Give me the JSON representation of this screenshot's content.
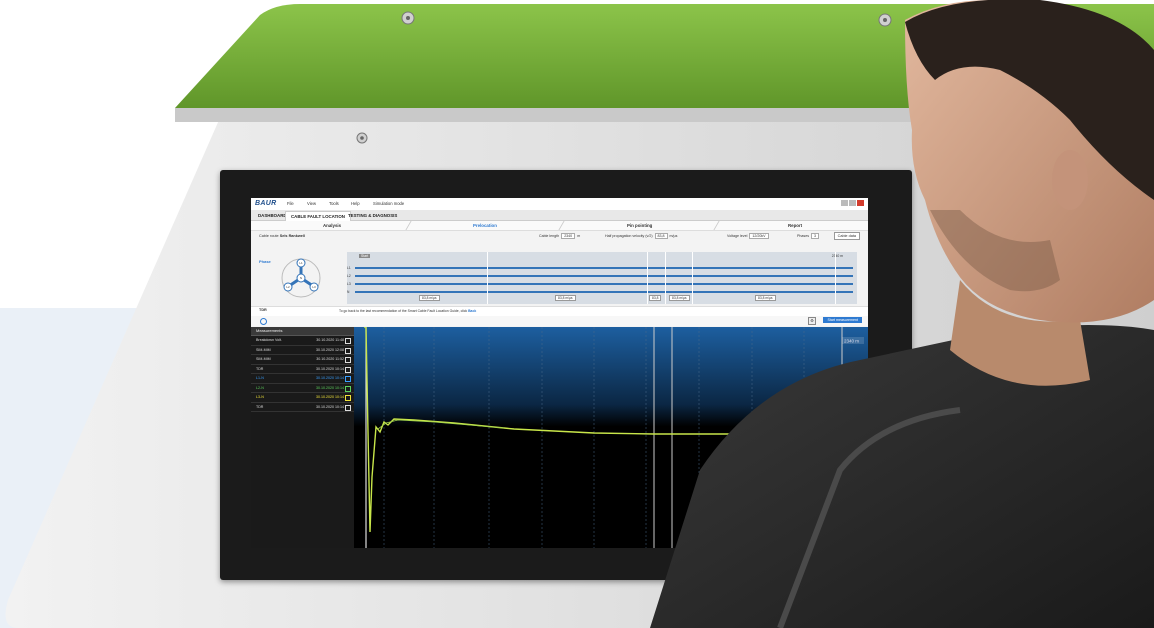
{
  "app": {
    "brand": "BAUR",
    "menu": [
      "File",
      "View",
      "Tools",
      "Help",
      "Simulation mode"
    ],
    "tabs": [
      "DASHBOARD",
      "CABLE FAULT LOCATION",
      "TESTING & DIAGNOSIS"
    ],
    "active_tab": "CABLE FAULT LOCATION",
    "steps": [
      "Analysis",
      "Prelocation",
      "Pin pointing",
      "Report"
    ],
    "active_step": "Prelocation"
  },
  "params": {
    "cable_route_label": "Cable route",
    "cable_route_value": "Sels Rankwell",
    "cable_length_label": "Cable length",
    "cable_length_value": "2340",
    "cable_length_unit": "m",
    "velocity_label": "Half propagation velocity (v/2)",
    "velocity_value": "83,8",
    "velocity_unit": "m/µs",
    "voltage_label": "Voltage level",
    "voltage_value": "12/20kV",
    "phases_label": "Phases",
    "phases_value": "3",
    "cable_data_button": "Cable data"
  },
  "phase_panel": {
    "label": "Phase",
    "nodes": [
      "L1",
      "L2",
      "L3",
      "N"
    ]
  },
  "cable_lines": {
    "labels": [
      "L1",
      "L2",
      "L3",
      "N"
    ],
    "start_label": "Start",
    "end_distance": "2340 m",
    "velocities": [
      "83,8 m/µs",
      "83,8 m/µs",
      "83,8",
      "83,8 m/µs",
      "83,8 m/µs"
    ]
  },
  "hint": {
    "selector": "TDR",
    "text": "To go back to the last recommendation of the Smart Cable Fault Location Guide, click",
    "link": "Back"
  },
  "toolbar": {
    "start_measurement": "Start measurement"
  },
  "sidebar": {
    "header": "Measurements",
    "rows": [
      {
        "name": "Breakdown Volt.",
        "date": "30.10.2020 11:48",
        "color": "#dddddd"
      },
      {
        "name": "SIM-MIM",
        "date": "30.10.2020 12:08",
        "color": "#dddddd"
      },
      {
        "name": "SIM-MIM",
        "date": "30.10.2020 11:52",
        "color": "#dddddd"
      },
      {
        "name": "TDR",
        "date": "30.10.2020 10:14",
        "color": "#dddddd"
      },
      {
        "name": "L1-N",
        "date": "30.10.2020 10:14",
        "color": "#3aa0ff"
      },
      {
        "name": "L2-N",
        "date": "30.10.2020 10:14",
        "color": "#5ed35e"
      },
      {
        "name": "L3-N",
        "date": "30.10.2020 10:14",
        "color": "#f0e23a"
      },
      {
        "name": "TDR",
        "date": "30.10.2020 10:14",
        "color": "#dddddd"
      }
    ]
  },
  "plot": {
    "distance_badge": "2340 m",
    "trace_colors": [
      "#c8e64a",
      "#5ed35e"
    ],
    "background_top": "#1d5fa0",
    "background_bottom": "#000000"
  },
  "colors": {
    "green_panel": "#7bb13c",
    "device_grey": "#dcdcdc",
    "accent": "#2e7ad1"
  }
}
